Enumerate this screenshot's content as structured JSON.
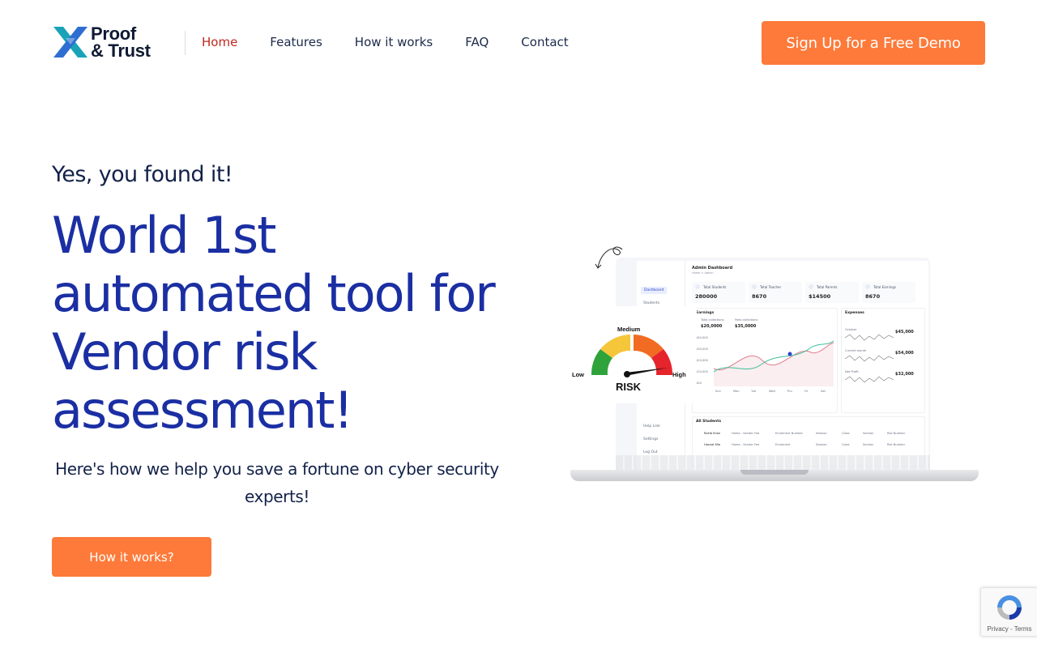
{
  "header": {
    "logo": {
      "line1": "Proof",
      "line2": "& Trust"
    },
    "nav": [
      {
        "label": "Home",
        "active": true
      },
      {
        "label": "Features",
        "active": false
      },
      {
        "label": "How it works",
        "active": false
      },
      {
        "label": "FAQ",
        "active": false
      },
      {
        "label": "Contact",
        "active": false
      }
    ],
    "cta_label": "Sign Up for a Free Demo"
  },
  "hero": {
    "eyebrow": "Yes, you found it!",
    "headline_lines": [
      "World 1st",
      "automated tool for",
      "Vendor risk",
      "assessment!"
    ],
    "subtext_line1": "Here's how we help you save a fortune on cyber security",
    "subtext_line2": "experts!",
    "button_label": "How it works?"
  },
  "illustration": {
    "dashboard": {
      "title": "Admin Dashboard",
      "breadcrumb": "Home  >  Admin",
      "sidebar_items": [
        "Dashboard",
        "Students",
        "Help Link",
        "Settings",
        "Log Out"
      ],
      "stats": [
        {
          "label": "Total Students",
          "value": "280000"
        },
        {
          "label": "Total Teacher",
          "value": "8670"
        },
        {
          "label": "Total Parents",
          "value": "$14500"
        },
        {
          "label": "Total Earnings",
          "value": "8670"
        }
      ],
      "earnings": {
        "title": "Earnings",
        "legend": [
          "Total collections",
          "Fees collections"
        ],
        "values": [
          "$20,0000",
          "$35,0000"
        ],
        "y_ticks": [
          "$40,000",
          "$30,000",
          "$20,000",
          "$10,000",
          "$00"
        ],
        "x_ticks": [
          "Sun",
          "Mon",
          "Tue",
          "Wed",
          "Thu",
          "Fri",
          "Sat"
        ]
      },
      "expenses": {
        "title": "Expenses",
        "rows": [
          {
            "label": "October",
            "value": "$45,000"
          },
          {
            "label": "Current month",
            "value": "$54,000"
          },
          {
            "label": "Net Profit",
            "value": "$32,000"
          }
        ]
      },
      "students": {
        "title": "All Students",
        "rows": [
          {
            "name": "Rakib Khan",
            "col2": "Home - Sender Fee",
            "col3": "Enrolment Number",
            "col4": "Session",
            "col5": "Class",
            "col6": "Section",
            "col7": "Roll Number"
          },
          {
            "name": "Hasnat Mia",
            "col2": "Home - Sender Fee",
            "col3": "Enrolment",
            "col4": "Session",
            "col5": "Class",
            "col6": "Section",
            "col7": "Roll Number"
          }
        ]
      }
    },
    "gauge": {
      "low": "Low",
      "medium": "Medium",
      "high": "High",
      "risk": "RISK",
      "colors": {
        "low": "#2ea33b",
        "low_mid": "#f5c53a",
        "mid_high": "#f26b22",
        "high": "#e5242b"
      }
    }
  },
  "recaptcha": {
    "privacy": "Privacy",
    "sep": " - ",
    "terms": "Terms"
  },
  "colors": {
    "accent": "#fd7a3a",
    "headline": "#1b2fa3",
    "active_nav": "#c0271e",
    "text": "#13224a"
  }
}
